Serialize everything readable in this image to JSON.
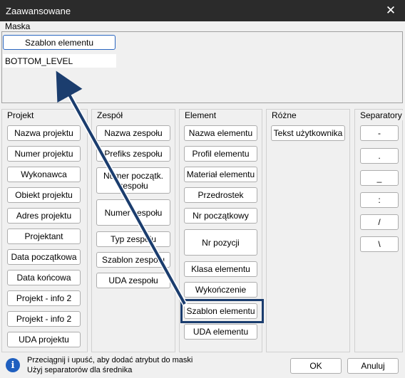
{
  "window": {
    "title": "Zaawansowane",
    "close_icon": "close-icon"
  },
  "mask": {
    "label": "Maska",
    "template_button": "Szablon elementu",
    "value": "BOTTOM_LEVEL"
  },
  "sections": {
    "projekt": {
      "label": "Projekt",
      "items": [
        "Nazwa projektu",
        "Numer projektu",
        "Wykonawca",
        "Obiekt projektu",
        "Adres projektu",
        "Projektant",
        "Data początkowa",
        "Data końcowa",
        "Projekt - info 2",
        "Projekt - info 2",
        "UDA projektu"
      ]
    },
    "zespol": {
      "label": "Zespół",
      "items": [
        "Nazwa zespołu",
        "Prefiks zespołu",
        "Numer początk. zespołu",
        "Numer zespołu",
        "Typ zespołu",
        "Szablon zespołu",
        "UDA zespołu"
      ]
    },
    "element": {
      "label": "Element",
      "items": [
        "Nazwa elementu",
        "Profil elementu",
        "Materiał elementu",
        "Przedrostek",
        "Nr początkowy",
        "Nr pozycji",
        "Klasa elementu",
        "Wykończenie",
        "Szablon elementu",
        "UDA elementu"
      ]
    },
    "rozne": {
      "label": "Różne",
      "items": [
        "Tekst użytkownika"
      ]
    },
    "separatory": {
      "label": "Separatory",
      "items": [
        "-",
        ".",
        "_",
        ":",
        "/",
        "\\"
      ]
    }
  },
  "footer": {
    "info_icon": "info-icon",
    "hint_line1": "Przeciągnij i upuść, aby dodać atrybut do maski",
    "hint_line2": "Użyj separatorów dla średnika",
    "ok_label": "OK",
    "cancel_label": "Anuluj"
  }
}
